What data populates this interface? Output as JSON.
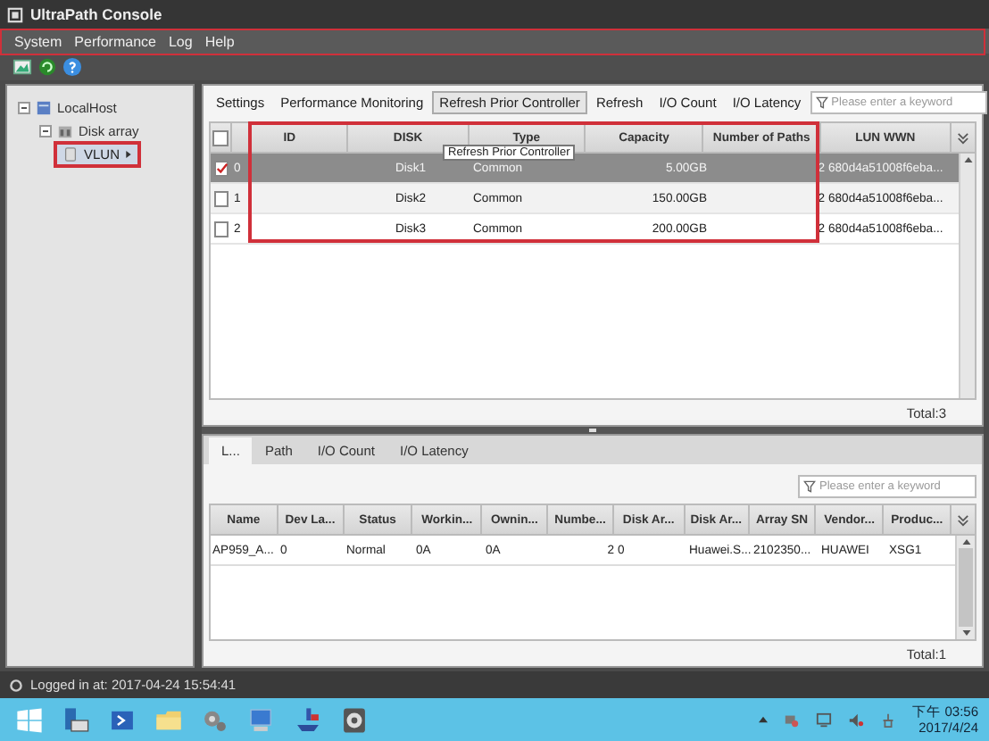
{
  "window": {
    "title": "UltraPath Console"
  },
  "menu": [
    "System",
    "Performance",
    "Log",
    "Help"
  ],
  "tree": {
    "label": "LocalHost",
    "expanded": true,
    "children": [
      {
        "label": "Disk array",
        "expanded": true,
        "children": [
          {
            "label": "VLUN",
            "selected": true
          }
        ]
      }
    ]
  },
  "top_tabs": [
    {
      "label": "Settings",
      "selected": false
    },
    {
      "label": "Performance Monitoring",
      "selected": false
    },
    {
      "label": "Refresh Prior Controller",
      "selected": true
    },
    {
      "label": "Refresh",
      "selected": false
    },
    {
      "label": "I/O Count",
      "selected": false
    },
    {
      "label": "I/O Latency",
      "selected": false
    }
  ],
  "top_search": {
    "placeholder": "Please enter a keyword"
  },
  "tooltip": "Refresh Prior Controller",
  "lun_table": {
    "all_checked": false,
    "columns": [
      "ID",
      "DISK",
      "Type",
      "Capacity",
      "Number of Paths",
      "LUN WWN"
    ],
    "rows": [
      {
        "checked": true,
        "selected": true,
        "cells": [
          "0",
          "Disk1",
          "Common",
          "5.00GB",
          "2",
          "680d4a51008f6eba..."
        ]
      },
      {
        "checked": false,
        "selected": false,
        "cells": [
          "1",
          "Disk2",
          "Common",
          "150.00GB",
          "2",
          "680d4a51008f6eba..."
        ]
      },
      {
        "checked": false,
        "selected": false,
        "cells": [
          "2",
          "Disk3",
          "Common",
          "200.00GB",
          "2",
          "680d4a51008f6eba..."
        ]
      }
    ],
    "total": "Total:3"
  },
  "bottom_tabs": [
    {
      "label": "L...",
      "selected": true
    },
    {
      "label": "Path",
      "selected": false
    },
    {
      "label": "I/O Count",
      "selected": false
    },
    {
      "label": "I/O Latency",
      "selected": false
    }
  ],
  "bottom_search": {
    "placeholder": "Please enter a keyword"
  },
  "path_table": {
    "columns": [
      "Name",
      "Dev La...",
      "Status",
      "Workin...",
      "Ownin...",
      "Numbe...",
      "Disk Ar...",
      "Disk Ar...",
      "Array SN",
      "Vendor...",
      "Produc..."
    ],
    "rows": [
      {
        "cells": [
          "AP959_A...",
          "0",
          "Normal",
          "0A",
          "0A",
          "2",
          "0",
          "Huawei.S...",
          "2102350...",
          "HUAWEI",
          "XSG1"
        ]
      }
    ],
    "total": "Total:1"
  },
  "status_bar": "Logged in at: 2017-04-24 15:54:41",
  "taskbar": {
    "time": "下午 03:56",
    "date": "2017/4/24"
  }
}
